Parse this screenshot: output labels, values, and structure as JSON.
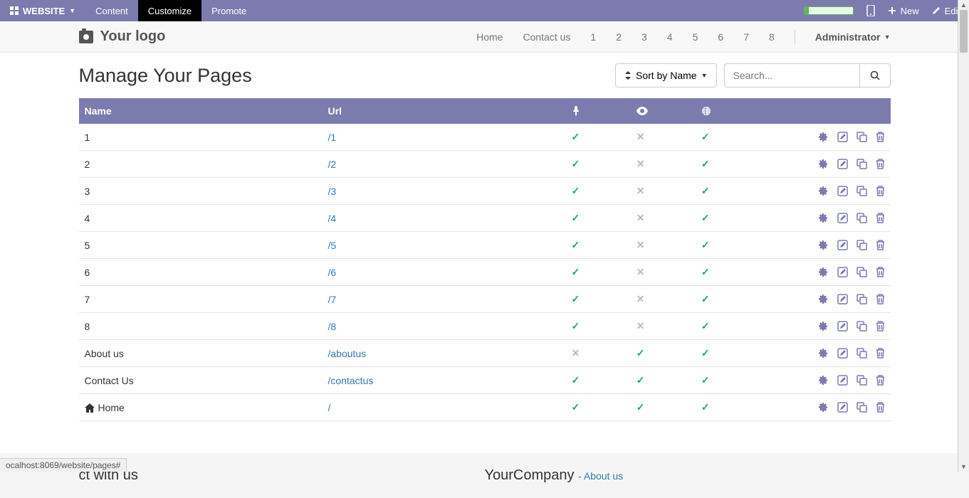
{
  "topbar": {
    "website_label": "WEBSITE",
    "items": [
      "Content",
      "Customize",
      "Promote"
    ],
    "active_index": 1,
    "new_label": "New",
    "edit_label": "Edit"
  },
  "header": {
    "logo_text": "Your logo",
    "nav_items": [
      "Home",
      "Contact us",
      "1",
      "2",
      "3",
      "4",
      "5",
      "6",
      "7",
      "8"
    ],
    "admin_label": "Administrator"
  },
  "page": {
    "title": "Manage Your Pages",
    "sort_label": "Sort by Name",
    "search_placeholder": "Search..."
  },
  "table": {
    "columns": {
      "name": "Name",
      "url": "Url"
    },
    "rows": [
      {
        "name": "1",
        "url": "/1",
        "pin": true,
        "eye": false,
        "globe": true,
        "home": false
      },
      {
        "name": "2",
        "url": "/2",
        "pin": true,
        "eye": false,
        "globe": true,
        "home": false
      },
      {
        "name": "3",
        "url": "/3",
        "pin": true,
        "eye": false,
        "globe": true,
        "home": false
      },
      {
        "name": "4",
        "url": "/4",
        "pin": true,
        "eye": false,
        "globe": true,
        "home": false
      },
      {
        "name": "5",
        "url": "/5",
        "pin": true,
        "eye": false,
        "globe": true,
        "home": false
      },
      {
        "name": "6",
        "url": "/6",
        "pin": true,
        "eye": false,
        "globe": true,
        "home": false
      },
      {
        "name": "7",
        "url": "/7",
        "pin": true,
        "eye": false,
        "globe": true,
        "home": false
      },
      {
        "name": "8",
        "url": "/8",
        "pin": true,
        "eye": false,
        "globe": true,
        "home": false
      },
      {
        "name": "About us",
        "url": "/aboutus",
        "pin": false,
        "eye": true,
        "globe": true,
        "home": false
      },
      {
        "name": "Contact Us",
        "url": "/contactus",
        "pin": true,
        "eye": true,
        "globe": true,
        "home": false
      },
      {
        "name": "Home",
        "url": "/",
        "pin": true,
        "eye": true,
        "globe": true,
        "home": true
      }
    ]
  },
  "footer": {
    "col1_suffix": "ct with us",
    "company": "YourCompany",
    "company_sub": "- About us"
  },
  "status_url": "ocalhost:8069/website/pages#"
}
